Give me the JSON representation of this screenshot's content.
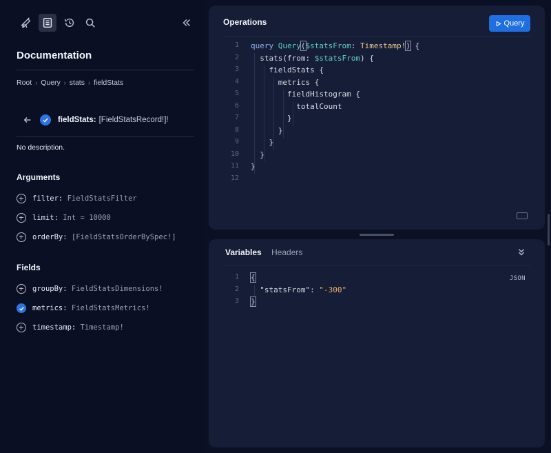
{
  "sidebar": {
    "toolbar": [
      {
        "name": "explorer-icon"
      },
      {
        "name": "docs-icon",
        "active": true
      },
      {
        "name": "history-icon"
      },
      {
        "name": "search-icon"
      },
      {
        "name": "collapse-icon"
      }
    ],
    "title": "Documentation",
    "breadcrumb": [
      "Root",
      "Query",
      "stats",
      "fieldStats"
    ],
    "field": {
      "name": "fieldStats:",
      "type": "[FieldStatsRecord!]!",
      "description": "No description."
    },
    "arguments_title": "Arguments",
    "arguments": [
      {
        "name": "filter:",
        "type": "FieldStatsFilter"
      },
      {
        "name": "limit:",
        "type": "Int = 10000"
      },
      {
        "name": "orderBy:",
        "type": "[FieldStatsOrderBySpec!]"
      }
    ],
    "fields_title": "Fields",
    "fields": [
      {
        "name": "groupBy:",
        "type": "FieldStatsDimensions!",
        "selected": false
      },
      {
        "name": "metrics:",
        "type": "FieldStatsMetrics!",
        "selected": true
      },
      {
        "name": "timestamp:",
        "type": "Timestamp!",
        "selected": false
      }
    ]
  },
  "operations": {
    "title": "Operations",
    "query_button": "Query",
    "line_numbers": [
      "1",
      "2",
      "3",
      "4",
      "5",
      "6",
      "7",
      "8",
      "9",
      "10",
      "11",
      "12"
    ]
  },
  "variables": {
    "tabs": [
      "Variables",
      "Headers"
    ],
    "format_label": "JSON",
    "line_numbers": [
      "1",
      "2",
      "3"
    ],
    "key": "\"statsFrom\"",
    "value": "\"-300\""
  },
  "colors": {
    "accent": "#1f6fe0",
    "panel": "#161d36",
    "background": "#0a0f24"
  }
}
